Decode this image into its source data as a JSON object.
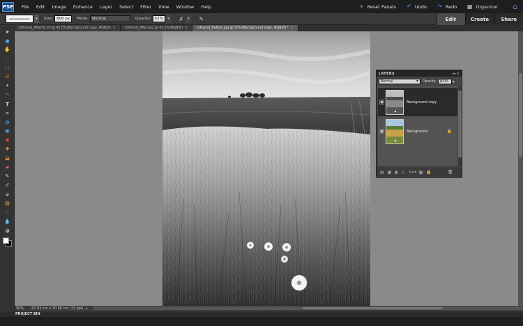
{
  "app": {
    "logo_text": "PSE"
  },
  "menu": [
    "File",
    "Edit",
    "Image",
    "Enhance",
    "Layer",
    "Select",
    "Filter",
    "View",
    "Window",
    "Help"
  ],
  "actions": {
    "reset_panels": "Reset Panels",
    "undo": "Undo",
    "redo": "Redo",
    "organizer": "Organizer"
  },
  "options": {
    "size_label": "Size:",
    "size_value": "800 px",
    "mode_label": "Mode:",
    "mode_value": "Normal",
    "opacity_label": "Opacity:",
    "opacity_value": "52%"
  },
  "mode_tabs": {
    "edit": "Edit",
    "create": "Create",
    "share": "Share",
    "active": "edit"
  },
  "doc_tabs": [
    {
      "label": "Infrared_After01.tif @ 43.5%(Background copy, RGB/8)",
      "active": false
    },
    {
      "label": "Infrared_After.jpg @ 43.5%(RGB/8)",
      "active": false
    },
    {
      "label": "Infrared_Before.jpg @ 50%(Background copy, RGB/8) *",
      "active": true
    }
  ],
  "status": {
    "zoom": "50%",
    "info": "47.03 cm x 70.56 cm (72 ppi)"
  },
  "project_bin": "PROJECT BIN",
  "layers_panel": {
    "title": "LAYERS",
    "blend_mode": "Normal",
    "opacity_label": "Opacity:",
    "opacity_value": "100%",
    "lock_label": "Lock:",
    "layers": [
      {
        "name": "Background copy",
        "selected": true,
        "locked": false,
        "style": "bw"
      },
      {
        "name": "Background",
        "selected": false,
        "locked": true,
        "style": "color"
      }
    ]
  }
}
